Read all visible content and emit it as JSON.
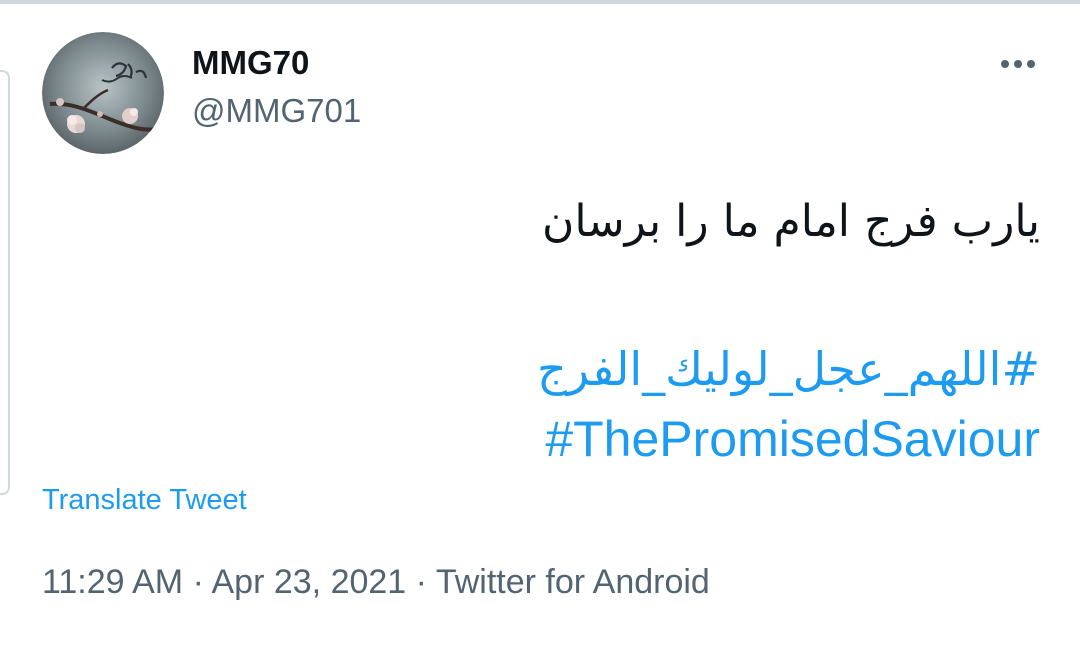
{
  "user": {
    "display_name": "MMG70",
    "handle": "@MMG701"
  },
  "tweet": {
    "text": "یارب فرج امام ما را برسان",
    "hashtags": [
      "#اللهم_عجل_لولیك_الفرج",
      "#ThePromisedSaviour"
    ]
  },
  "actions": {
    "translate_label": "Translate Tweet",
    "more_icon": "more-horizontal-icon"
  },
  "meta": {
    "time": "11:29 AM",
    "separator": "·",
    "date": "Apr 23, 2021",
    "source": "Twitter for Android"
  },
  "colors": {
    "link": "#1d9bf0",
    "text": "#0f1419",
    "secondary": "#536471",
    "border": "#cfd9de"
  }
}
